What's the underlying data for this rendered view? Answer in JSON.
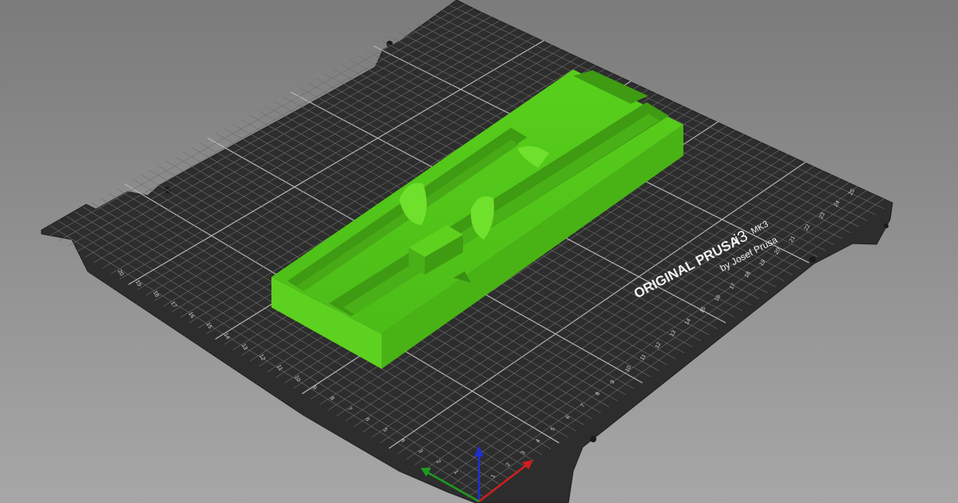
{
  "viewport": {
    "background_top": "#7b7b7b",
    "background_bottom": "#a7a7a7"
  },
  "bed": {
    "title": "ORIGINAL PRUSA",
    "model_main": "i3",
    "model_sub": "MK3",
    "byline": "by Josef Prusa",
    "x_ticks": [
      "1",
      "2",
      "3",
      "4",
      "5",
      "6",
      "7",
      "8",
      "9",
      "10",
      "11",
      "12",
      "13",
      "14",
      "15",
      "16",
      "17",
      "18",
      "19",
      "20",
      "21",
      "22",
      "23",
      "24",
      "25"
    ],
    "y_ticks": [
      "20",
      "19",
      "18",
      "17",
      "16",
      "15",
      "14",
      "13",
      "12",
      "11",
      "10",
      "9",
      "8",
      "7",
      "6",
      "5",
      "4",
      "3",
      "2",
      "1"
    ],
    "sheet_color": "#2d2d2d",
    "grid_color": "#8a8a8a"
  },
  "object": {
    "name": "tray-model",
    "top_color": "#52c41a",
    "side_light": "#5ed11f",
    "side_dark": "#3f9c12"
  },
  "axes": {
    "x_color": "#d01f1f",
    "y_color": "#1f9a1f",
    "z_color": "#1f2fd0"
  }
}
